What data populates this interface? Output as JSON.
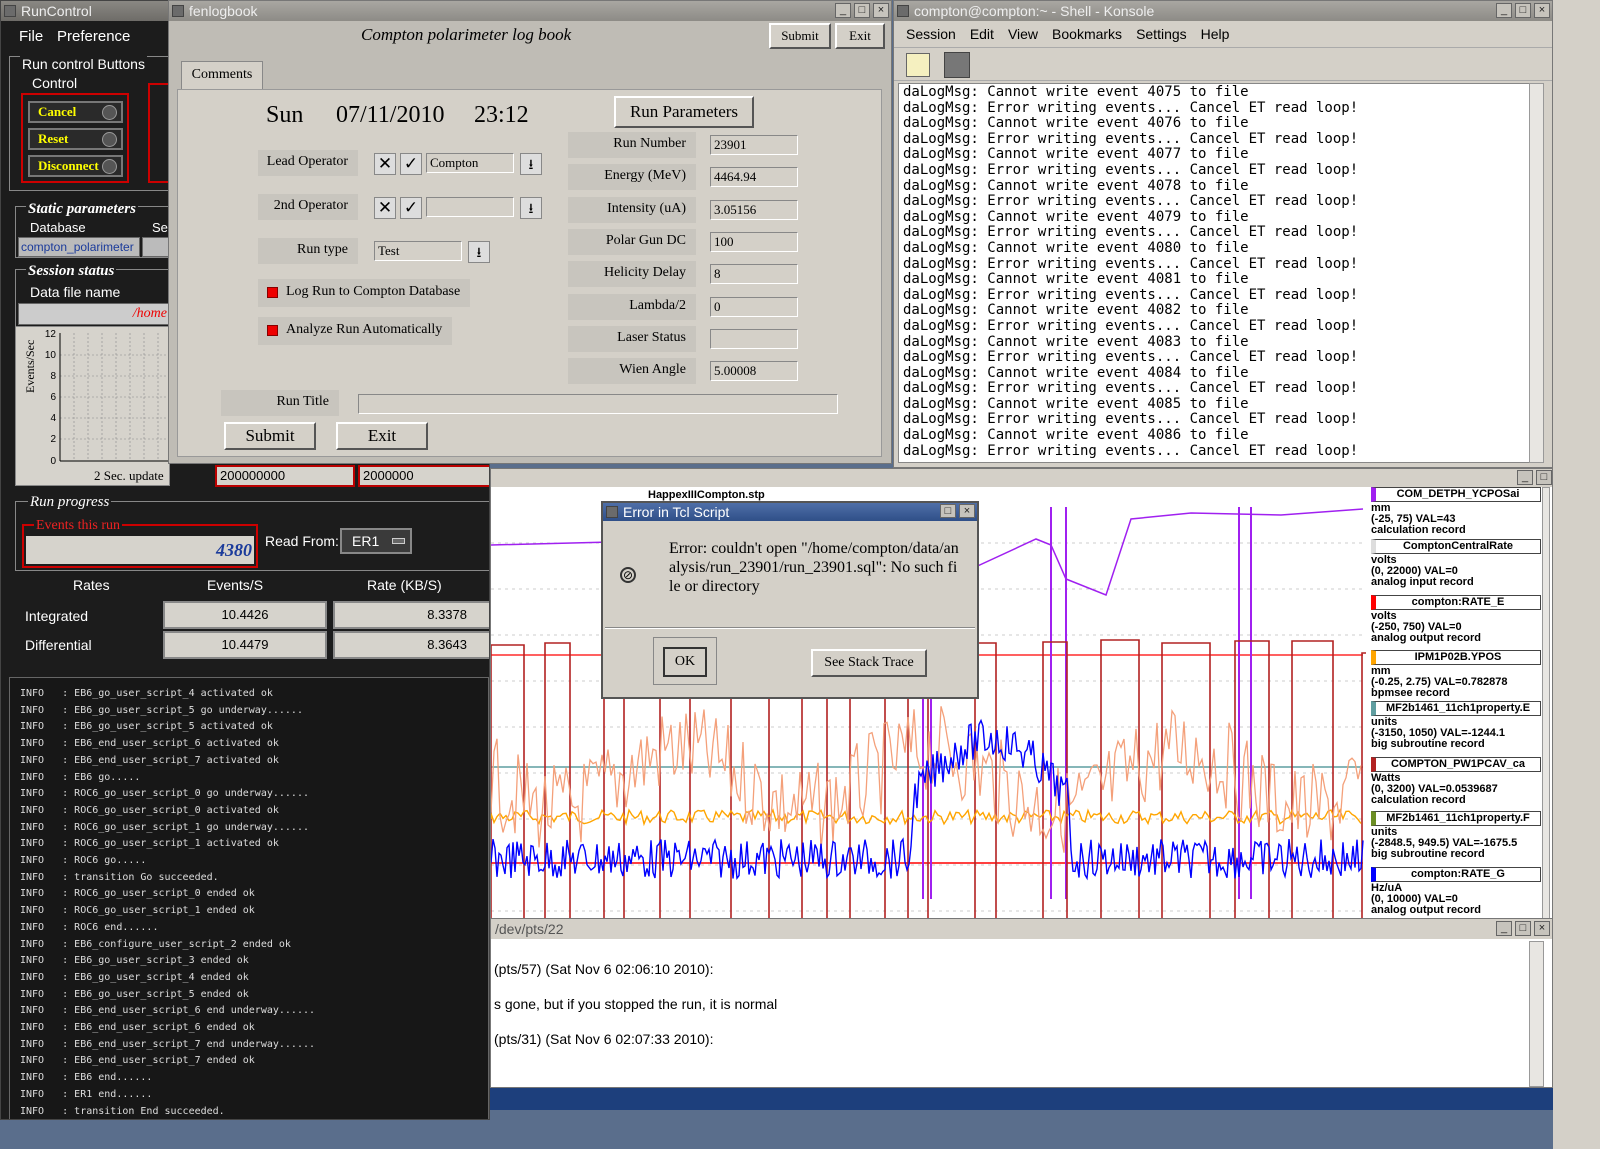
{
  "runcontrol": {
    "title": "RunControl",
    "menu": [
      "File",
      "Preference"
    ],
    "buttons_group": "Run control Buttons",
    "control_label": "Control",
    "cancel": "Cancel",
    "reset": "Reset",
    "disconnect": "Disconnect",
    "static_params": "Static parameters",
    "database_label": "Database",
    "database_value": "compton_polarimeter",
    "se_label": "Se",
    "session_status": "Session status",
    "data_file_label": "Data file name",
    "data_file_value": "/home",
    "plot_ylabel": "Events/Sec",
    "plot_yticks": [
      "12",
      "10",
      "8",
      "6",
      "4",
      "2",
      "0"
    ],
    "update_label": "2 Sec. update",
    "field1": "200000000",
    "field2": "2000000",
    "run_progress": "Run progress",
    "events_this_run": "Events this run",
    "events_value": "4380",
    "read_from_label": "Read From:",
    "read_from_value": "ER1",
    "rates_header": [
      "Rates",
      "Events/S",
      "Rate (KB/S)"
    ],
    "integrated_label": "Integrated",
    "integrated_events": "10.4426",
    "integrated_rate": "8.3378",
    "differential_label": "Differential",
    "differential_events": "10.4479",
    "differential_rate": "8.3643"
  },
  "log_lines": [
    "INFO   : EB6_go_user_script_4 activated ok",
    "INFO   : EB6_go_user_script_5 go underway......",
    "INFO   : EB6_go_user_script_5 activated ok",
    "INFO   : EB6_end_user_script_6 activated ok",
    "INFO   : EB6_end_user_script_7 activated ok",
    "INFO   : EB6 go.....",
    "INFO   : ROC6_go_user_script_0 go underway......",
    "INFO   : ROC6_go_user_script_0 activated ok",
    "INFO   : ROC6_go_user_script_1 go underway......",
    "INFO   : ROC6_go_user_script_1 activated ok",
    "INFO   : ROC6 go.....",
    "INFO   : transition Go succeeded.",
    "INFO   : ROC6_go_user_script_0 ended ok",
    "INFO   : ROC6_go_user_script_1 ended ok",
    "INFO   : ROC6 end......",
    "INFO   : EB6_configure_user_script_2 ended ok",
    "INFO   : EB6_go_user_script_3 ended ok",
    "INFO   : EB6_go_user_script_4 ended ok",
    "INFO   : EB6_go_user_script_5 ended ok",
    "INFO   : EB6_end_user_script_6 end underway......",
    "INFO   : EB6_end_user_script_6 ended ok",
    "INFO   : EB6_end_user_script_7 end underway......",
    "INFO   : EB6_end_user_script_7 ended ok",
    "INFO   : EB6 end......",
    "INFO   : ER1 end......",
    "INFO   : transition End succeeded."
  ],
  "logbook": {
    "title": "fenlogbook",
    "heading": "Compton polarimeter log book",
    "submit_top": "Submit",
    "exit_top": "Exit",
    "tab": "Comments",
    "day": "Sun",
    "date": "07/11/2010",
    "time": "23:12",
    "lead_operator_label": "Lead Operator",
    "lead_operator_value": "Compton",
    "second_operator_label": "2nd Operator",
    "second_operator_value": "",
    "run_type_label": "Run type",
    "run_type_value": "Test",
    "log_run_label": "Log Run to Compton Database",
    "analyze_label": "Analyze Run Automatically",
    "run_title_label": "Run Title",
    "run_title_value": "",
    "submit": "Submit",
    "exit": "Exit",
    "run_params_button": "Run Parameters",
    "params": [
      {
        "label": "Run Number",
        "value": "23901"
      },
      {
        "label": "Energy (MeV)",
        "value": "4464.94"
      },
      {
        "label": "Intensity (uA)",
        "value": "3.05156"
      },
      {
        "label": "Polar Gun DC",
        "value": "100"
      },
      {
        "label": "Helicity Delay",
        "value": "8"
      },
      {
        "label": "Lambda/2",
        "value": "0"
      },
      {
        "label": "Laser Status",
        "value": ""
      },
      {
        "label": "Wien Angle",
        "value": "5.00008"
      }
    ]
  },
  "konsole": {
    "title": "compton@compton:~ - Shell - Konsole",
    "menu": [
      "Session",
      "Edit",
      "View",
      "Bookmarks",
      "Settings",
      "Help"
    ],
    "lines": [
      "daLogMsg: Cannot write event 4075 to file",
      "daLogMsg: Error writing events... Cancel ET read loop!",
      "daLogMsg: Cannot write event 4076 to file",
      "daLogMsg: Error writing events... Cancel ET read loop!",
      "daLogMsg: Cannot write event 4077 to file",
      "daLogMsg: Error writing events... Cancel ET read loop!",
      "daLogMsg: Cannot write event 4078 to file",
      "daLogMsg: Error writing events... Cancel ET read loop!",
      "daLogMsg: Cannot write event 4079 to file",
      "daLogMsg: Error writing events... Cancel ET read loop!",
      "daLogMsg: Cannot write event 4080 to file",
      "daLogMsg: Error writing events... Cancel ET read loop!",
      "daLogMsg: Cannot write event 4081 to file",
      "daLogMsg: Error writing events... Cancel ET read loop!",
      "daLogMsg: Cannot write event 4082 to file",
      "daLogMsg: Error writing events... Cancel ET read loop!",
      "daLogMsg: Cannot write event 4083 to file",
      "daLogMsg: Error writing events... Cancel ET read loop!",
      "daLogMsg: Cannot write event 4084 to file",
      "daLogMsg: Error writing events... Cancel ET read loop!",
      "daLogMsg: Cannot write event 4085 to file",
      "daLogMsg: Error writing events... Cancel ET read loop!",
      "daLogMsg: Cannot write event 4086 to file",
      "daLogMsg: Error writing events... Cancel ET read loop!"
    ]
  },
  "stripchart": {
    "title": "HappexIIICompton.stp",
    "signals": [
      {
        "name": "COM_DETPH_YCPOSai",
        "unit": "mm",
        "range": "(-25, 75) VAL=43",
        "type": "calculation record",
        "color": "#a020f0"
      },
      {
        "name": "ComptonCentralRate",
        "unit": "volts",
        "range": "(0, 22000) VAL=0",
        "type": "analog input record",
        "color": "#ffffff"
      },
      {
        "name": "compton:RATE_E",
        "unit": "volts",
        "range": "(-250, 750) VAL=0",
        "type": "analog output record",
        "color": "#ff0000"
      },
      {
        "name": "IPM1P02B.YPOS",
        "unit": "mm",
        "range": "(-0.25, 2.75) VAL=0.782878",
        "type": "bpmsee record",
        "color": "#ffa500"
      },
      {
        "name": "MF2b1461_11ch1property.E",
        "unit": "units",
        "range": "(-3150, 1050) VAL=-1244.1",
        "type": "big subroutine record",
        "color": "#5f9ea0"
      },
      {
        "name": "COMPTON_PW1PCAV_ca",
        "unit": "Watts",
        "range": "(0, 3200) VAL=0.0539687",
        "type": "calculation record",
        "color": "#b22222"
      },
      {
        "name": "MF2b1461_11ch1property.F",
        "unit": "units",
        "range": "(-2848.5, 949.5) VAL=-1675.5",
        "type": "big subroutine record",
        "color": "#6b8e23"
      },
      {
        "name": "compton:RATE_G",
        "unit": "Hz/uA",
        "range": "(0, 10000) VAL=0",
        "type": "analog output record",
        "color": "#0000ff"
      }
    ]
  },
  "error_dialog": {
    "title": "Error in Tcl Script",
    "message": "Error: couldn't open \"/home/compton/data/analysis/run_23901/run_23901.sql\": No such file or directory",
    "ok": "OK",
    "stack_trace": "See Stack Trace"
  },
  "terminal": {
    "title": "/dev/pts/22",
    "lines": [
      "(pts/57) (Sat Nov  6 02:06:10 2010):",
      "s gone, but if you stopped the run, it is normal",
      "(pts/31) (Sat Nov  6 02:07:33 2010):"
    ]
  }
}
